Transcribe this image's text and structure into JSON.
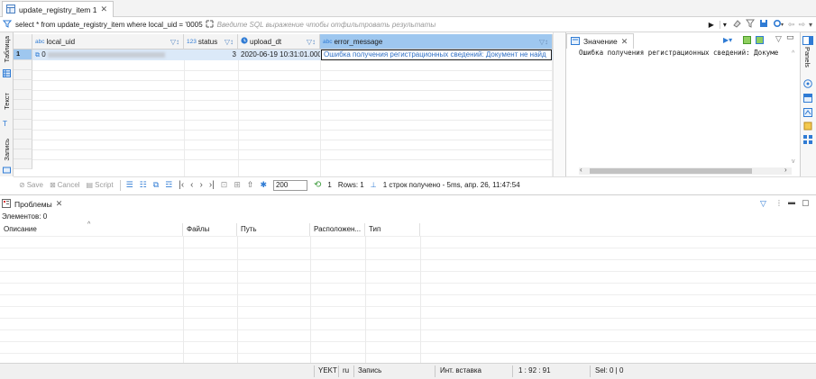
{
  "editor": {
    "tab_title": "update_registry_item 1"
  },
  "filter": {
    "query": "select * from update_registry_item where local_uid = '0005",
    "placeholder": "Введите SQL выражение чтобы отфильтровать результаты"
  },
  "side_tabs": [
    "Таблица",
    "Текст",
    "Запись"
  ],
  "grid": {
    "columns": [
      {
        "type_badge": "abc",
        "name": "local_uid"
      },
      {
        "type_badge": "123",
        "name": "status"
      },
      {
        "type_badge": "clock-icon",
        "name": "upload_dt"
      },
      {
        "type_badge": "abc",
        "name": "error_message"
      }
    ],
    "rows": [
      {
        "num": "1",
        "local_uid": "0",
        "status": "3",
        "upload_dt": "2020-06-19 10:31:01.000",
        "error_message": "Ошибка получения регистрационных сведений: Документ не найд"
      }
    ]
  },
  "grid_toolbar": {
    "save": "Save",
    "cancel": "Cancel",
    "script": "Script",
    "fetch_size": "200",
    "refresh_count": "1",
    "rows_label": "Rows: 1",
    "summary": "1 строк получено - 5ms, апр. 26, 11:47:54"
  },
  "value_panel": {
    "tab_title": "Значение",
    "text": "Ошибка получения регистрационных сведений: Докуме"
  },
  "right_strip": {
    "label": "Panels"
  },
  "problems": {
    "tab_title": "Проблемы",
    "count": "Элементов: 0",
    "columns": [
      "Описание",
      "Файлы",
      "Путь",
      "Расположен...",
      "Тип"
    ]
  },
  "status_bar": {
    "timezone": "YEKT",
    "locale": "ru",
    "mode": "Запись",
    "insert": "Инт. вставка",
    "position": "1 : 92 : 91",
    "selection": "Sel: 0 | 0"
  },
  "colors": {
    "selection": "#9ec7ef",
    "accent": "#2f7bd4"
  }
}
